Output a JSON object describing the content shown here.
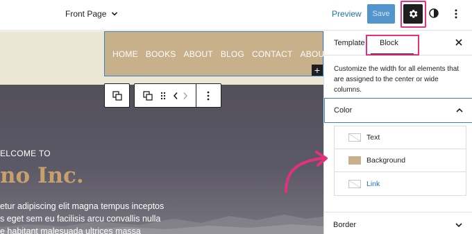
{
  "topbar": {
    "doc_title": "Front Page",
    "preview_label": "Preview",
    "save_label": "Save"
  },
  "canvas": {
    "nav_items": [
      "HOME",
      "BOOKS",
      "ABOUT",
      "BLOG",
      "CONTACT",
      "ABOUT"
    ],
    "hero": {
      "welcome": "ELCOME TO",
      "title": "no Inc.",
      "lines": [
        "etur adipiscing elit magna tempus inceptos",
        "s eget sem eu facilisis arcu convallis nulla",
        "e habitant malesuada ultrices massa"
      ]
    },
    "add_block_glyph": "+"
  },
  "sidebar": {
    "tabs": {
      "template": "Template",
      "block": "Block"
    },
    "description": "Customize the width for all elements that are assigned to the center or wide columns.",
    "color_panel": {
      "title": "Color",
      "items": [
        {
          "label": "Text",
          "swatch": "none"
        },
        {
          "label": "Background",
          "swatch": "#c8b08a"
        },
        {
          "label": "Link",
          "swatch": "none"
        }
      ]
    },
    "border_panel": {
      "title": "Border"
    }
  },
  "colors": {
    "accent_blue": "#3582c4",
    "highlight_pink": "#e3317f",
    "nav_background": "#c8b08a",
    "hero_title_gold": "#c8a06c"
  }
}
